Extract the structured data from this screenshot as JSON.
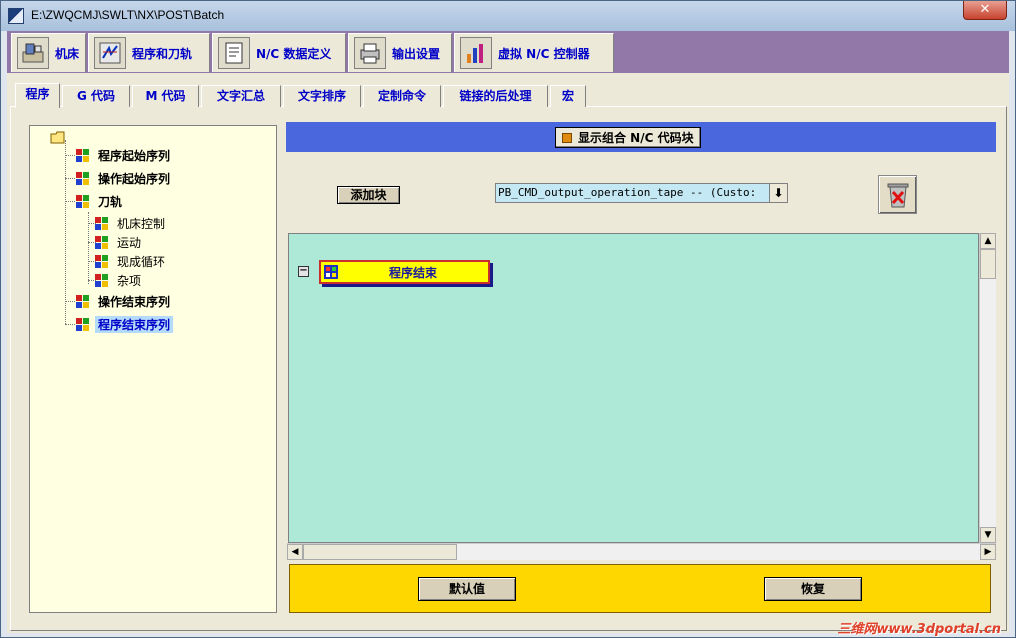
{
  "window": {
    "title": "E:\\ZWQCMJ\\SWLT\\NX\\POST\\Batch",
    "close_label": "✕"
  },
  "top_tabs": [
    {
      "label": "机床",
      "icon": "machine-icon"
    },
    {
      "label": "程序和刀轨",
      "icon": "program-path-icon"
    },
    {
      "label": "N/C 数据定义",
      "icon": "nc-data-icon"
    },
    {
      "label": "输出设置",
      "icon": "printer-icon"
    },
    {
      "label": "虚拟 N/C 控制器",
      "icon": "virtual-controller-icon"
    }
  ],
  "sub_tabs": [
    "程序",
    "G 代码",
    "M 代码",
    "文字汇总",
    "文字排序",
    "定制命令",
    "链接的后处理",
    "宏"
  ],
  "tree": {
    "items": [
      {
        "label": "程序起始序列",
        "bold": true
      },
      {
        "label": "操作起始序列",
        "bold": true
      },
      {
        "label": "刀轨",
        "bold": true
      },
      {
        "label": "机床控制",
        "bold": false
      },
      {
        "label": "运动",
        "bold": false
      },
      {
        "label": "现成循环",
        "bold": false
      },
      {
        "label": "杂项",
        "bold": false
      },
      {
        "label": "操作结束序列",
        "bold": true
      },
      {
        "label": "程序结束序列",
        "bold": true,
        "selected": true
      }
    ]
  },
  "panel": {
    "checkbox_label": "显示组合 N/C 代码块",
    "add_block_label": "添加块",
    "combo_value": "PB_CMD_output_operation_tape -- (Custo:",
    "block_label": "程序结束",
    "collapse_symbol": "−",
    "default_button": "默认值",
    "restore_button": "恢复"
  },
  "watermark": "三维网www.3dportal.cn",
  "colors": {
    "accent_blue": "#4a67de",
    "canvas_bg": "#aee8d6",
    "bottom_bar": "#ffd700",
    "tab_text": "#0000c8",
    "top_bar_purple": "#9178a8"
  }
}
